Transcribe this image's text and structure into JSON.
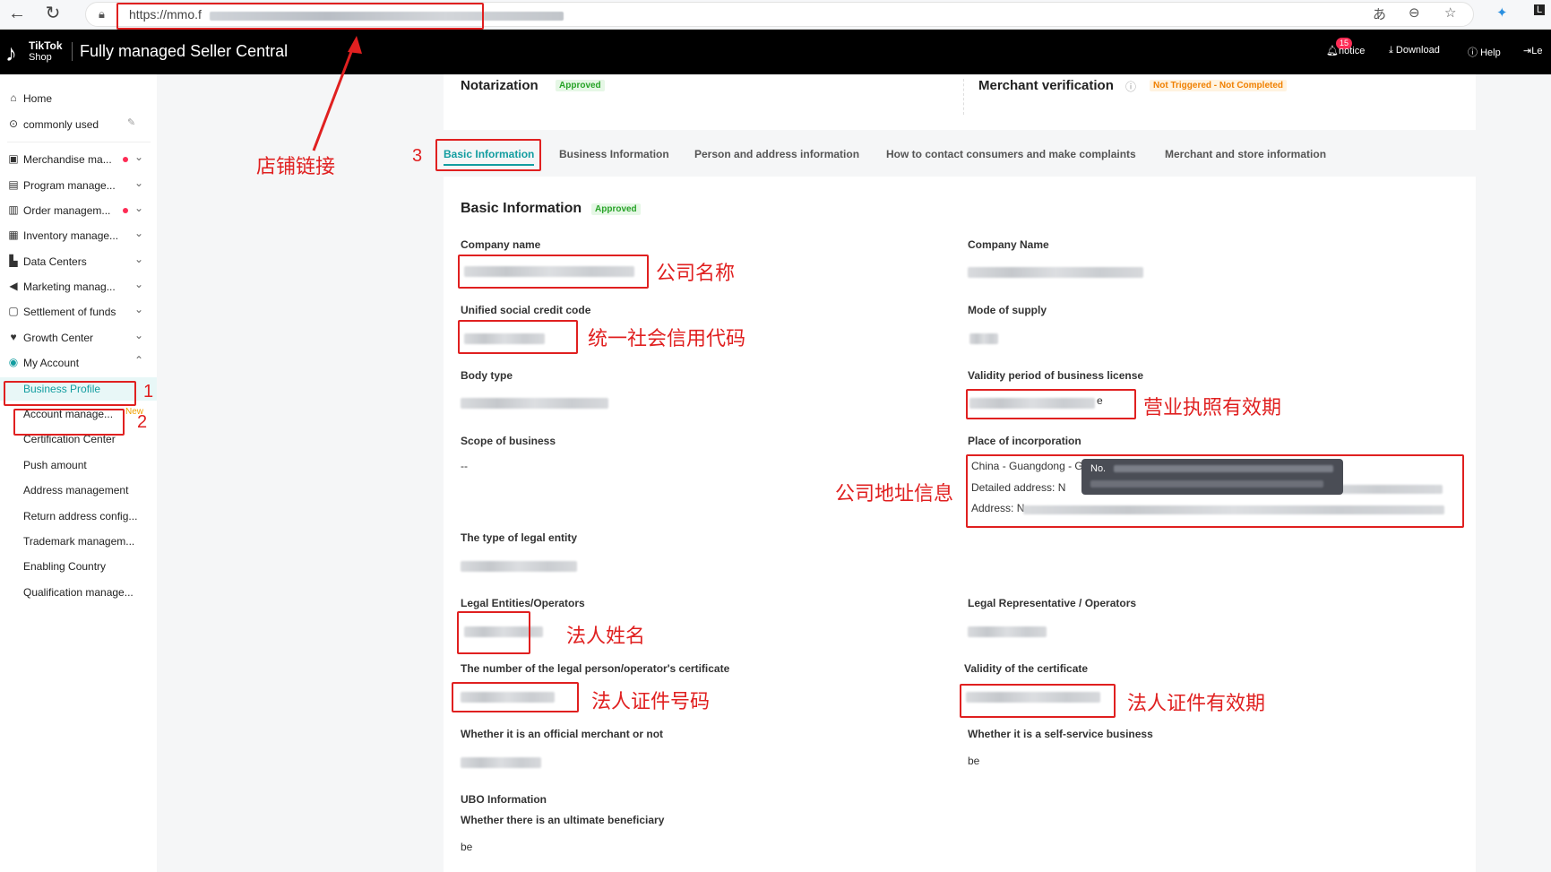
{
  "browser": {
    "url": "https://mmo.f",
    "icons": [
      "back-icon",
      "reload-icon",
      "lock-icon",
      "translate-icon",
      "zoom-icon",
      "star-icon",
      "extension-icon",
      "profile-icon"
    ]
  },
  "header": {
    "logo_line1": "TikTok",
    "logo_line2": "Shop",
    "title": "Fully managed Seller Central",
    "notice_count": "15",
    "notice_label": "notice",
    "download_label": "Download",
    "help_label": "Help",
    "last_label": "Le"
  },
  "sidebar": {
    "home": "Home",
    "commonly_used": "commonly used",
    "items": [
      {
        "label": "Merchandise ma...",
        "dot": true
      },
      {
        "label": "Program manage...",
        "dot": false
      },
      {
        "label": "Order managem...",
        "dot": true
      },
      {
        "label": "Inventory manage...",
        "dot": false
      },
      {
        "label": "Data Centers",
        "dot": false
      },
      {
        "label": "Marketing manag...",
        "dot": false
      },
      {
        "label": "Settlement of funds",
        "dot": false
      },
      {
        "label": "Growth Center",
        "dot": false
      },
      {
        "label": "My Account",
        "dot": false
      }
    ],
    "sub_items": [
      {
        "label": "Business Profile",
        "active": true
      },
      {
        "label": "Account manage...",
        "new": "New"
      },
      {
        "label": "Certification Center"
      },
      {
        "label": "Push amount"
      },
      {
        "label": "Address management"
      },
      {
        "label": "Return address config..."
      },
      {
        "label": "Trademark managem..."
      },
      {
        "label": "Enabling Country"
      },
      {
        "label": "Qualification manage..."
      }
    ]
  },
  "status": {
    "notarization_title": "Notarization",
    "notarization_badge": "Approved",
    "merchant_title": "Merchant verification",
    "merchant_badge": "Not Triggered - Not Completed"
  },
  "tabs": [
    "Basic Information",
    "Business Information",
    "Person and address information",
    "How to contact consumers and make complaints",
    "Merchant and store information"
  ],
  "basic": {
    "title": "Basic Information",
    "badge": "Approved",
    "company_name_label": "Company name",
    "company_name2_label": "Company Name",
    "credit_code_label": "Unified social credit code",
    "mode_supply_label": "Mode of supply",
    "body_type_label": "Body type",
    "validity_license_label": "Validity period of business license",
    "validity_license_suffix": "e",
    "scope_label": "Scope of business",
    "scope_value": "--",
    "place_label": "Place of incorporation",
    "place_line1": "China - Guangdong - G",
    "place_line2": "Detailed address: N",
    "place_line3": "Address: N",
    "tooltip_prefix": "No.",
    "legal_entity_type_label": "The type of legal entity",
    "legal_ops_label": "Legal Entities/Operators",
    "legal_rep_label": "Legal Representative / Operators",
    "cert_number_label": "The number of the legal person/operator's certificate",
    "cert_validity_label": "Validity of the certificate",
    "official_label": "Whether it is an official merchant or not",
    "self_service_label": "Whether it is a self-service business",
    "self_service_value": "be",
    "ubo_title": "UBO Information",
    "ubo_label": "Whether there is an ultimate beneficiary",
    "ubo_value": "be"
  },
  "annotations": {
    "store_link": "店铺链接",
    "company_name": "公司名称",
    "credit_code": "统一社会信用代码",
    "license_validity": "营业执照有效期",
    "address_info": "公司地址信息",
    "legal_name": "法人姓名",
    "cert_number": "法人证件号码",
    "cert_validity": "法人证件有效期",
    "step1": "1",
    "step2": "2",
    "step3": "3"
  },
  "colors": {
    "accent": "#129da0",
    "annotation_red": "#e02020",
    "approved_green": "#27a327",
    "warn_orange": "#f08000",
    "header_bg": "#000000"
  }
}
